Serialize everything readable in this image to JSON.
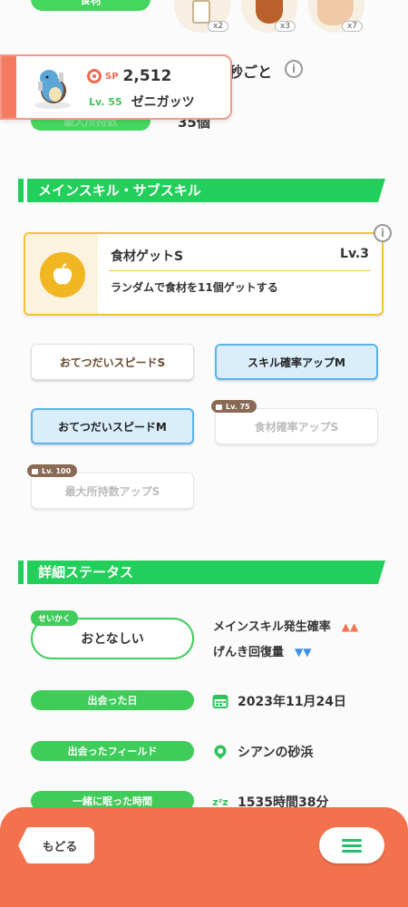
{
  "top": {
    "ingredient_label": "食材",
    "ingredients": [
      {
        "name": "milk",
        "count": "x2"
      },
      {
        "name": "cacao",
        "count": "x3"
      },
      {
        "name": "potato",
        "count": "x7"
      }
    ],
    "help_interval_partial": "秒ごと",
    "max_carry_label_partial": "最大所持数",
    "max_carry_value_partial": "35個"
  },
  "pokemon": {
    "sp_label": "SP",
    "sp_value": "2,512",
    "level": "Lv. 55",
    "name": "ゼニガッツ"
  },
  "skills_section": {
    "title": "メインスキル・サブスキル",
    "main_skill": {
      "name": "食材ゲットS",
      "level": "Lv.3",
      "description": "ランダムで食材を11個ゲットする"
    },
    "sub_skills": [
      {
        "label": "おてつだいスピードS",
        "style": "white",
        "lock": ""
      },
      {
        "label": "スキル確率アップM",
        "style": "blue",
        "lock": ""
      },
      {
        "label": "おてつだいスピードM",
        "style": "blue",
        "lock": ""
      },
      {
        "label": "食材確率アップS",
        "style": "locked",
        "lock": "Lv. 75"
      },
      {
        "label": "最大所持数アップS",
        "style": "locked",
        "lock": "Lv. 100"
      }
    ]
  },
  "details_section": {
    "title": "詳細ステータス",
    "nature_label": "せいかく",
    "nature": "おとなしい",
    "up_effect": "メインスキル発生確率",
    "up_arrows": "▲▲",
    "down_effect": "げんき回復量",
    "down_arrows": "▼▼",
    "rows": [
      {
        "label": "出会った日",
        "value": "2023年11月24日",
        "icon": "calendar-icon"
      },
      {
        "label": "出会ったフィールド",
        "value": "シアンの砂浜",
        "icon": "location-icon"
      },
      {
        "label": "一緒に眠った時間",
        "value": "1535時間38分",
        "icon": "sleep-zzz-icon"
      }
    ]
  },
  "bottom": {
    "back_label": "もどる",
    "menu_icon": "hamburger-icon"
  },
  "colors": {
    "accent_green": "#23cf5b",
    "accent_orange": "#f4714e",
    "skill_yellow": "#f0c23a",
    "sub_blue": "#5bb2e8"
  }
}
